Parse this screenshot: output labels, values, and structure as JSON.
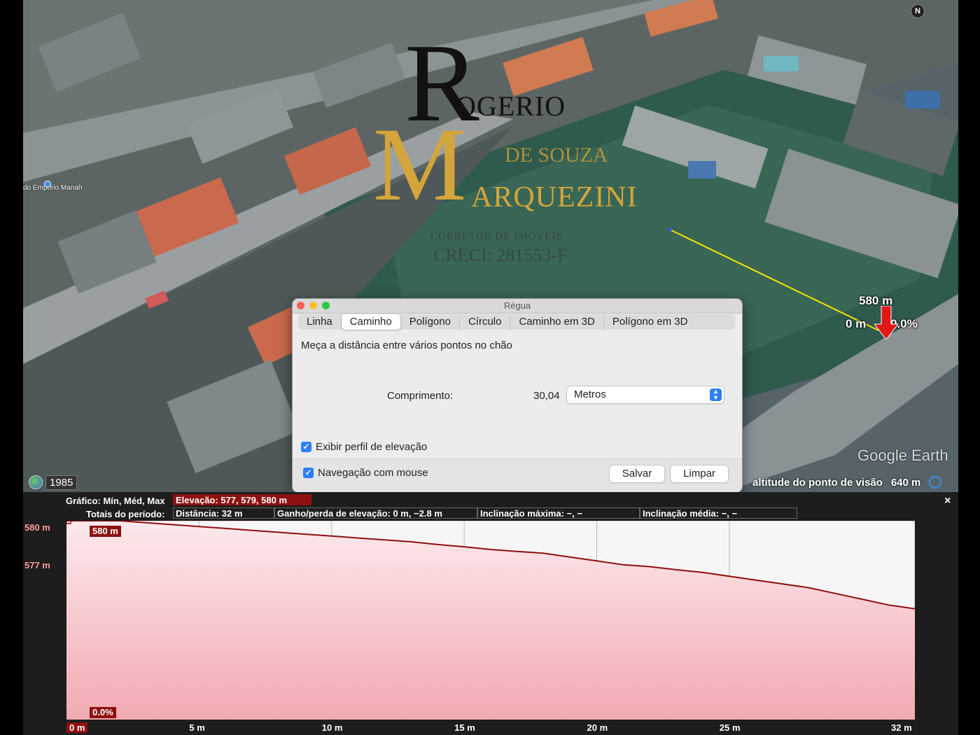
{
  "map": {
    "poi_label": "do Emporio Manah",
    "watermark": {
      "initial_r": "R",
      "name_first": "OGERIO",
      "initial_m": "M",
      "middle": "DE SOUZA",
      "last": "ARQUEZINI",
      "role": "CORRETOR DE IMOVEIS",
      "creci": "CRECI: 281553-F"
    },
    "path_start_elevation": "580 m",
    "path_start_distance": "0 m",
    "path_start_slope": "0.0%",
    "compass": "N",
    "logo": "Google Earth",
    "historical_year": "1985",
    "eye_alt_label": "altitude do ponto de visão",
    "eye_alt_value": "640 m"
  },
  "dialog": {
    "title": "Régua",
    "tabs": [
      {
        "label": "Linha",
        "active": false
      },
      {
        "label": "Caminho",
        "active": true
      },
      {
        "label": "Polígono",
        "active": false
      },
      {
        "label": "Círculo",
        "active": false
      },
      {
        "label": "Caminho em 3D",
        "active": false
      },
      {
        "label": "Polígono em 3D",
        "active": false
      }
    ],
    "description": "Meça a distância entre vários pontos no chão",
    "length_label": "Comprimento:",
    "length_value": "30,04",
    "unit_selected": "Metros",
    "show_profile_label": "Exibir perfil de elevação",
    "show_profile_checked": true,
    "mouse_nav_label": "Navegação com mouse",
    "mouse_nav_checked": true,
    "save_label": "Salvar",
    "clear_label": "Limpar"
  },
  "elevation": {
    "graph_label": "Gráfico: Mín, Méd, Max",
    "graph_value": "Elevação: 577, 579, 580 m",
    "totals_label": "Totais do período:",
    "distance": "Distância: 32 m",
    "gain_loss": "Ganho/perda de elevação: 0 m, −2.8 m",
    "max_slope": "Inclinação máxima: −, −",
    "avg_slope": "Inclinação média: −, −",
    "close_label": "×",
    "marker_elev": "580 m",
    "marker_slope": "0.0%",
    "marker_dist": "0 m",
    "accent": "#8e1010",
    "fill_top": "#fde9ec",
    "fill_bottom": "#f2aab2"
  },
  "chart_data": {
    "type": "area",
    "xlabel": "",
    "ylabel": "",
    "x_unit": "m",
    "y_unit": "m",
    "xlim": [
      0,
      32
    ],
    "ylim": [
      574.8,
      580
    ],
    "x_ticks": [
      "0 m",
      "5 m",
      "10 m",
      "15 m",
      "20 m",
      "25 m",
      "32 m"
    ],
    "x_tick_values": [
      0,
      5,
      10,
      15,
      20,
      25,
      32
    ],
    "y_ticks": [
      "580 m",
      "577 m"
    ],
    "y_tick_values": [
      580,
      577
    ],
    "grid": true,
    "series": [
      {
        "x": [
          0,
          1,
          2,
          3,
          4,
          5,
          6,
          7,
          8,
          9,
          10,
          11,
          12,
          13,
          14,
          15,
          16,
          17,
          18,
          19,
          20,
          21,
          22,
          23,
          24,
          25,
          26,
          27,
          28,
          29,
          30,
          31,
          32
        ],
        "values": [
          580,
          580,
          580,
          579.95,
          579.9,
          579.85,
          579.8,
          579.75,
          579.7,
          579.65,
          579.6,
          579.55,
          579.5,
          579.45,
          579.38,
          579.32,
          579.25,
          579.2,
          579.15,
          579.05,
          578.95,
          578.85,
          578.8,
          578.72,
          578.65,
          578.55,
          578.45,
          578.35,
          578.25,
          578.1,
          577.95,
          577.8,
          577.7
        ]
      }
    ]
  }
}
